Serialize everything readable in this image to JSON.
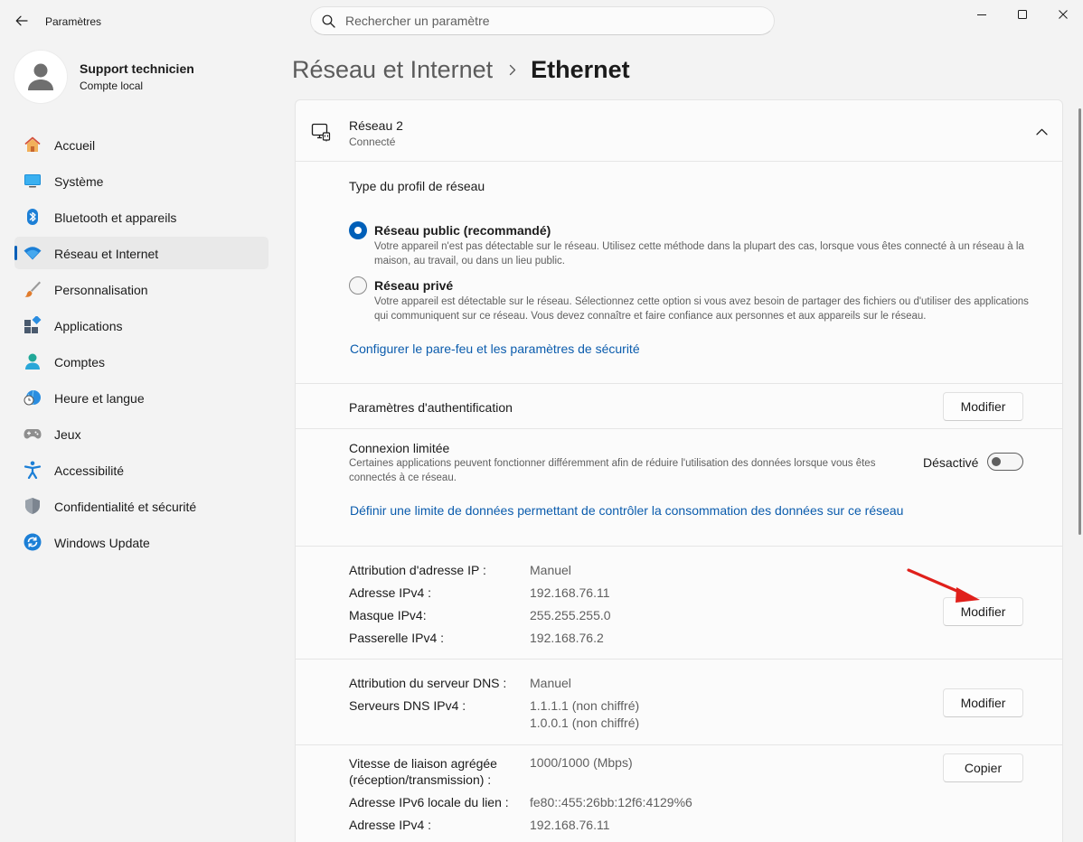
{
  "app": {
    "title": "Paramètres"
  },
  "search": {
    "placeholder": "Rechercher un paramètre"
  },
  "profile": {
    "name": "Support technicien",
    "subtitle": "Compte local"
  },
  "sidebar": {
    "items": [
      {
        "label": "Accueil",
        "icon": "home-icon"
      },
      {
        "label": "Système",
        "icon": "system-icon"
      },
      {
        "label": "Bluetooth et appareils",
        "icon": "bluetooth-icon"
      },
      {
        "label": "Réseau et Internet",
        "icon": "wifi-icon",
        "active": true
      },
      {
        "label": "Personnalisation",
        "icon": "brush-icon"
      },
      {
        "label": "Applications",
        "icon": "apps-icon"
      },
      {
        "label": "Comptes",
        "icon": "account-icon"
      },
      {
        "label": "Heure et langue",
        "icon": "clock-globe-icon"
      },
      {
        "label": "Jeux",
        "icon": "gamepad-icon"
      },
      {
        "label": "Accessibilité",
        "icon": "accessibility-icon"
      },
      {
        "label": "Confidentialité et sécurité",
        "icon": "shield-icon"
      },
      {
        "label": "Windows Update",
        "icon": "update-icon"
      }
    ]
  },
  "breadcrumb": {
    "parent": "Réseau et Internet",
    "current": "Ethernet"
  },
  "network": {
    "name": "Réseau 2",
    "status": "Connecté"
  },
  "profile_type": {
    "heading": "Type du profil de réseau",
    "public": {
      "label": "Réseau public (recommandé)",
      "description": "Votre appareil n'est pas détectable sur le réseau. Utilisez cette méthode dans la plupart des cas, lorsque vous êtes connecté à un réseau à la maison, au travail, ou dans un lieu public.",
      "selected": true
    },
    "private": {
      "label": "Réseau privé",
      "description": "Votre appareil est détectable sur le réseau. Sélectionnez cette option si vous avez besoin de partager des fichiers ou d'utiliser des applications qui communiquent sur ce réseau. Vous devez connaître et faire confiance aux personnes et aux appareils sur le réseau.",
      "selected": false
    },
    "firewall_link": "Configurer le pare-feu et les paramètres de sécurité"
  },
  "auth": {
    "label": "Paramètres d'authentification",
    "button": "Modifier"
  },
  "metered": {
    "label": "Connexion limitée",
    "description": "Certaines applications peuvent fonctionner différemment afin de réduire l'utilisation des données lorsque vous êtes connectés à ce réseau.",
    "state_label": "Désactivé",
    "enabled": false,
    "data_limit_link": "Définir une limite de données permettant de contrôler la consommation des données sur ce réseau"
  },
  "ip": {
    "rows": [
      {
        "label": "Attribution d'adresse IP :",
        "value": "Manuel"
      },
      {
        "label": "Adresse IPv4 :",
        "value": "192.168.76.11"
      },
      {
        "label": "Masque IPv4:",
        "value": "255.255.255.0"
      },
      {
        "label": "Passerelle IPv4 :",
        "value": "192.168.76.2"
      }
    ],
    "button": "Modifier"
  },
  "dns": {
    "assignment_label": "Attribution du serveur DNS :",
    "assignment_value": "Manuel",
    "servers_label": "Serveurs DNS IPv4 :",
    "servers": [
      "1.1.1.1 (non chiffré)",
      "1.0.0.1 (non chiffré)"
    ],
    "button": "Modifier"
  },
  "properties": {
    "speed_label_1": "Vitesse de liaison agrégée",
    "speed_label_2": "(réception/transmission) :",
    "speed_value": "1000/1000 (Mbps)",
    "ipv6_label": "Adresse IPv6 locale du lien :",
    "ipv6_value": "fe80::455:26bb:12f6:4129%6",
    "ipv4_label": "Adresse IPv4 :",
    "ipv4_value": "192.168.76.11",
    "button": "Copier"
  },
  "colors": {
    "accent": "#005fb8",
    "link": "#0b5cad",
    "annotation_arrow": "#e0201b"
  }
}
